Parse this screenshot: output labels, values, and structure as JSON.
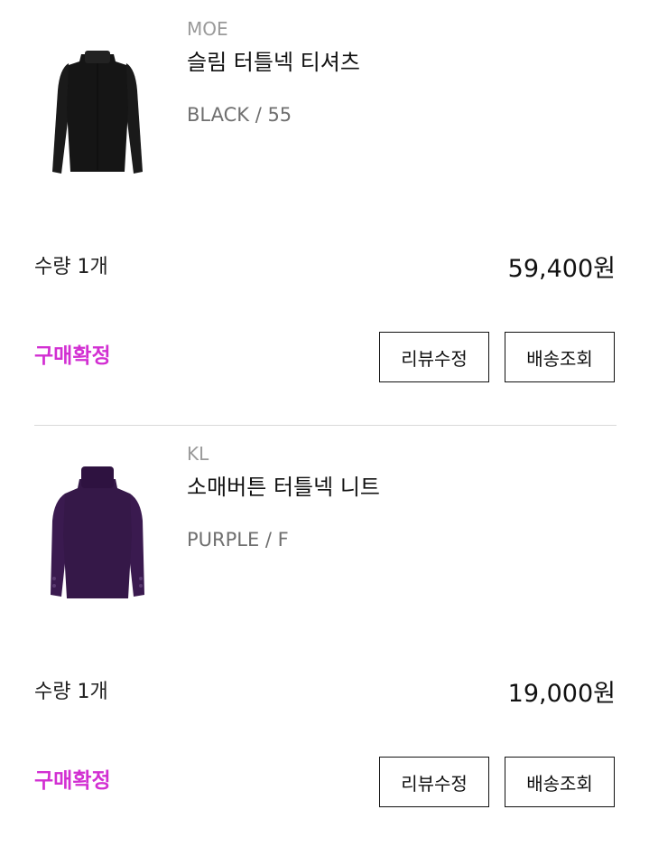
{
  "orders": [
    {
      "brand": "MOE",
      "name": "슬림 터틀넥 티셔츠",
      "option": "BLACK / 55",
      "quantity": "수량 1개",
      "price": "59,400원",
      "status": "구매확정",
      "review_button": "리뷰수정",
      "track_button": "배송조회",
      "product_color": "#151515"
    },
    {
      "brand": "KL",
      "name": "소매버튼 터틀넥 니트",
      "option": "PURPLE / F",
      "quantity": "수량 1개",
      "price": "19,000원",
      "status": "구매확정",
      "review_button": "리뷰수정",
      "track_button": "배송조회",
      "product_color": "#3a1a4f"
    }
  ],
  "colors": {
    "status": "#d22fd2",
    "divider": "#d9d9d9"
  }
}
